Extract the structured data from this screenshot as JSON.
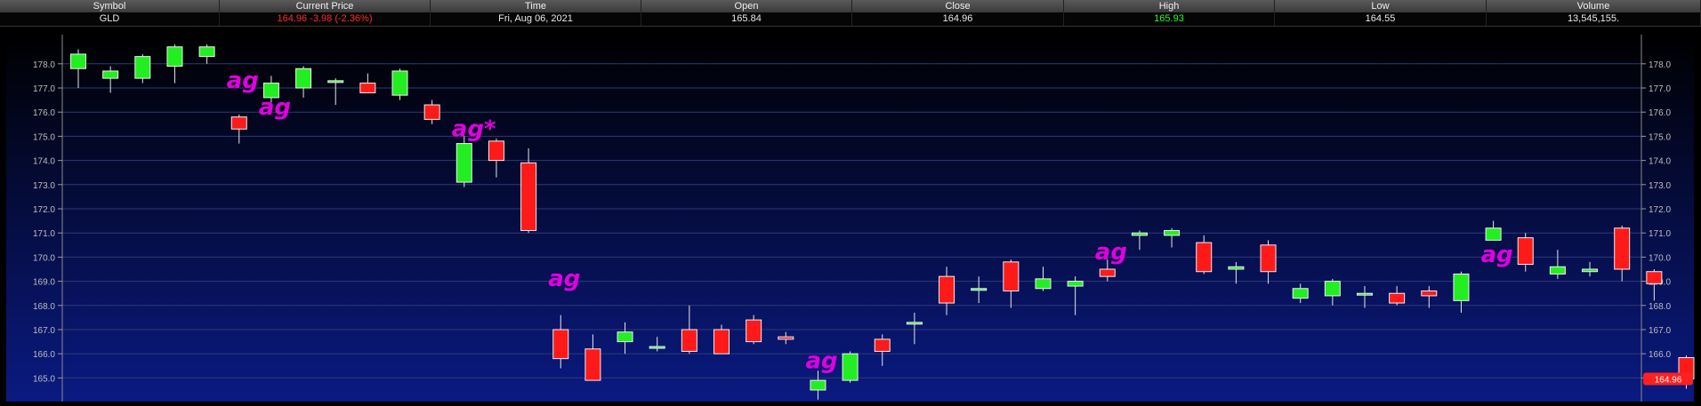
{
  "quote": {
    "headers": [
      "Symbol",
      "Current Price",
      "Time",
      "Open",
      "Close",
      "High",
      "Low",
      "Volume"
    ],
    "values": {
      "symbol": "GLD",
      "current_price": "164.96 -3.98 (-2.36%)",
      "time": "Fri, Aug 06, 2021",
      "open": "165.84",
      "close": "164.96",
      "high": "165.93",
      "low": "164.55",
      "volume": "13,545,155."
    }
  },
  "colors": {
    "up": "#22ee22",
    "down": "#ff1a1a",
    "annotation": "#e000e0",
    "price_tag": "#ff2020"
  },
  "chart_data": {
    "type": "candlestick",
    "y_ticks": [
      "165.0",
      "166.0",
      "167.0",
      "168.0",
      "169.0",
      "170.0",
      "171.0",
      "172.0",
      "173.0",
      "174.0",
      "175.0",
      "176.0",
      "177.0",
      "178.0"
    ],
    "ylim": [
      164.1,
      178.9
    ],
    "grid": true,
    "last_price_label": "164.96",
    "candles": [
      {
        "o": 177.8,
        "h": 178.6,
        "l": 177.0,
        "c": 178.4
      },
      {
        "o": 177.4,
        "h": 177.9,
        "l": 176.8,
        "c": 177.7
      },
      {
        "o": 177.4,
        "h": 178.4,
        "l": 177.2,
        "c": 178.3
      },
      {
        "o": 177.9,
        "h": 178.8,
        "l": 177.2,
        "c": 178.7
      },
      {
        "o": 178.3,
        "h": 178.8,
        "l": 178.0,
        "c": 178.7
      },
      {
        "o": 175.8,
        "h": 175.9,
        "l": 174.7,
        "c": 175.3
      },
      {
        "o": 176.6,
        "h": 177.5,
        "l": 176.4,
        "c": 177.2
      },
      {
        "o": 177.0,
        "h": 177.9,
        "l": 176.6,
        "c": 177.8
      },
      {
        "o": 177.3,
        "h": 177.4,
        "l": 176.3,
        "c": 177.3
      },
      {
        "o": 177.2,
        "h": 177.6,
        "l": 176.8,
        "c": 176.8
      },
      {
        "o": 176.7,
        "h": 177.8,
        "l": 176.5,
        "c": 177.7
      },
      {
        "o": 176.3,
        "h": 176.5,
        "l": 175.5,
        "c": 175.7
      },
      {
        "o": 173.1,
        "h": 175.0,
        "l": 172.9,
        "c": 174.7
      },
      {
        "o": 174.8,
        "h": 174.9,
        "l": 173.3,
        "c": 174.0
      },
      {
        "o": 173.9,
        "h": 174.5,
        "l": 171.0,
        "c": 171.1
      },
      {
        "o": 167.0,
        "h": 167.6,
        "l": 165.4,
        "c": 165.8
      },
      {
        "o": 166.2,
        "h": 166.8,
        "l": 164.9,
        "c": 164.9
      },
      {
        "o": 166.5,
        "h": 167.3,
        "l": 166.0,
        "c": 166.9
      },
      {
        "o": 166.3,
        "h": 166.7,
        "l": 166.1,
        "c": 166.3
      },
      {
        "o": 167.0,
        "h": 168.0,
        "l": 166.0,
        "c": 166.1
      },
      {
        "o": 167.0,
        "h": 167.2,
        "l": 166.0,
        "c": 166.0
      },
      {
        "o": 167.4,
        "h": 167.6,
        "l": 166.4,
        "c": 166.5
      },
      {
        "o": 166.7,
        "h": 166.9,
        "l": 166.4,
        "c": 166.6
      },
      {
        "o": 164.5,
        "h": 165.3,
        "l": 164.1,
        "c": 164.9
      },
      {
        "o": 164.9,
        "h": 166.1,
        "l": 164.8,
        "c": 166.0
      },
      {
        "o": 166.6,
        "h": 166.8,
        "l": 165.5,
        "c": 166.1
      },
      {
        "o": 167.3,
        "h": 167.7,
        "l": 166.4,
        "c": 167.3
      },
      {
        "o": 169.2,
        "h": 169.6,
        "l": 167.6,
        "c": 168.1
      },
      {
        "o": 168.7,
        "h": 169.2,
        "l": 168.1,
        "c": 168.7
      },
      {
        "o": 169.8,
        "h": 169.9,
        "l": 167.9,
        "c": 168.6
      },
      {
        "o": 168.7,
        "h": 169.6,
        "l": 168.6,
        "c": 169.1
      },
      {
        "o": 168.8,
        "h": 169.2,
        "l": 167.6,
        "c": 169.0
      },
      {
        "o": 169.5,
        "h": 169.9,
        "l": 169.0,
        "c": 169.2
      },
      {
        "o": 170.9,
        "h": 171.1,
        "l": 170.3,
        "c": 171.0
      },
      {
        "o": 170.9,
        "h": 171.2,
        "l": 170.4,
        "c": 171.1
      },
      {
        "o": 170.6,
        "h": 170.9,
        "l": 169.3,
        "c": 169.4
      },
      {
        "o": 169.5,
        "h": 169.8,
        "l": 168.9,
        "c": 169.6
      },
      {
        "o": 170.5,
        "h": 170.7,
        "l": 168.9,
        "c": 169.4
      },
      {
        "o": 168.3,
        "h": 168.9,
        "l": 168.1,
        "c": 168.7
      },
      {
        "o": 168.4,
        "h": 169.1,
        "l": 168.0,
        "c": 169.0
      },
      {
        "o": 168.5,
        "h": 168.8,
        "l": 167.9,
        "c": 168.5
      },
      {
        "o": 168.5,
        "h": 168.8,
        "l": 168.0,
        "c": 168.1
      },
      {
        "o": 168.6,
        "h": 168.8,
        "l": 167.9,
        "c": 168.4
      },
      {
        "o": 168.2,
        "h": 169.4,
        "l": 167.7,
        "c": 169.3
      },
      {
        "o": 170.7,
        "h": 171.5,
        "l": 170.7,
        "c": 171.2
      },
      {
        "o": 170.8,
        "h": 171.0,
        "l": 169.4,
        "c": 169.7
      },
      {
        "o": 169.3,
        "h": 170.3,
        "l": 169.1,
        "c": 169.6
      },
      {
        "o": 169.4,
        "h": 169.8,
        "l": 169.2,
        "c": 169.5
      },
      {
        "o": 171.2,
        "h": 171.3,
        "l": 169.0,
        "c": 169.5
      },
      {
        "o": 169.4,
        "h": 169.5,
        "l": 168.2,
        "c": 168.9
      },
      {
        "o": 165.84,
        "h": 165.93,
        "l": 164.55,
        "c": 164.96
      }
    ],
    "annotations": [
      {
        "text": "ag",
        "index": 5,
        "price": 177.0
      },
      {
        "text": "ag",
        "index": 6,
        "price": 175.9
      },
      {
        "text": "ag*",
        "index": 12,
        "price": 175.0
      },
      {
        "text": "ag",
        "index": 15,
        "price": 168.8
      },
      {
        "text": "ag",
        "index": 23,
        "price": 165.4
      },
      {
        "text": "ag",
        "index": 32,
        "price": 169.9
      },
      {
        "text": "ag",
        "index": 44,
        "price": 169.8
      }
    ]
  }
}
